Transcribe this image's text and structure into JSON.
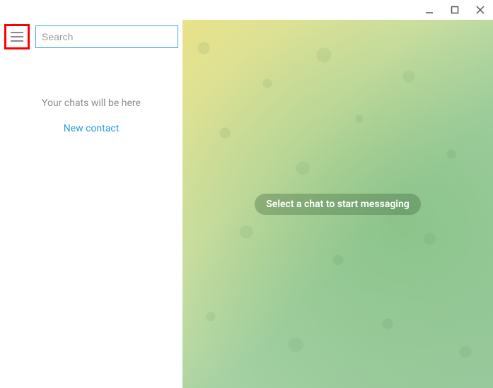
{
  "window_controls": {
    "minimize": "minimize",
    "maximize": "maximize",
    "close": "close"
  },
  "sidebar": {
    "search_placeholder": "Search",
    "empty_message": "Your chats will be here",
    "new_contact_label": "New contact"
  },
  "chat": {
    "placeholder_message": "Select a chat to start messaging"
  }
}
